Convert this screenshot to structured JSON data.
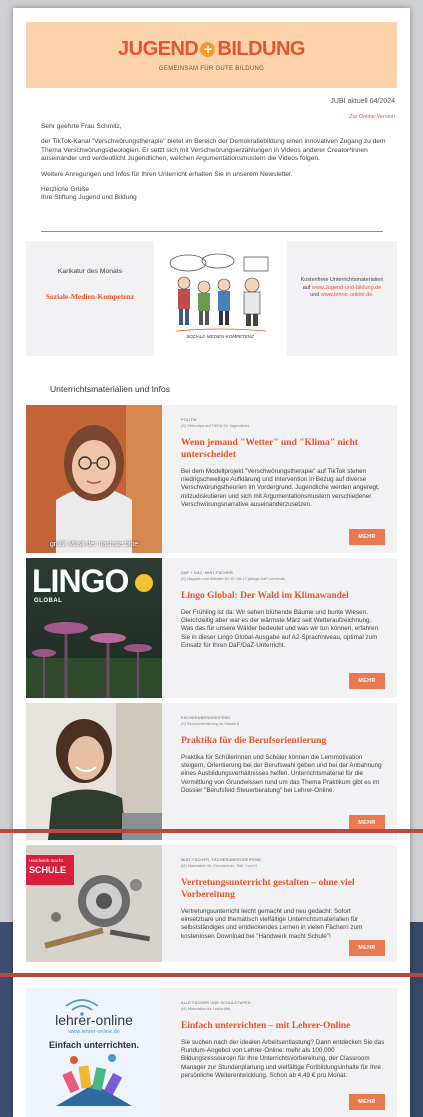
{
  "header": {
    "logo_left": "JUGEND",
    "logo_plus": "+",
    "logo_right": "BILDUNG",
    "tagline": "GEMEINSAM FÜR GUTE BILDUNG"
  },
  "issue": "JUBI aktuell 04/2024",
  "online_link": "Zur Online-Version",
  "letter": {
    "greeting": "Sehr geehrte Frau Schmitz,",
    "p1": "der TikTok-Kanal \"Verschwörungstherapie\" bietet im Bereich der Demokratiebildung einen innovativen Zugang zu dem Thema Verschwörungsideologien. Er setzt sich mit Verschwörungserzählungen in Videos anderer Creator*innen auseinander und verdeutlicht Jugendlichen, welchen Argumentationsmustern die Videos folgen.",
    "p2": "Weitere Anregungen und Infos für Ihren Unterricht erhalten Sie in unserem Newsletter.",
    "closing": "Herzliche Grüße",
    "signature": "Ihre Stiftung Jugend und Bildung"
  },
  "karikatur": {
    "title": "Karikatur des Monats",
    "subtitle": "Soziale-Medien-Kompetenz",
    "cartoon_caption": "SOZIALE-MEDIEN-KOMPETENZ",
    "right_text1": "Kostenfreie Unterrichtsmaterialien",
    "right_text2": "auf",
    "right_link1": "www.Jugend-und-bildung.de",
    "right_text3": "und",
    "right_link2": "www.lehrer-online.de."
  },
  "section_title": "Unterrichtsmaterialien und Infos",
  "cards": [
    {
      "category": "POLITIK",
      "sub": "(S) Videoclips auf TikTok für Jugendliche",
      "title": "Wenn jemand \"Wetter\" und \"Klima\" nicht unterscheidet",
      "text": "Bei dem Modellprojekt \"Verschwörungstherapie\" auf TikTok stehen niedrigschwellige Aufklärung und Intervention in Bezug auf diverse Verschwörungstheorien im Vordergrund. Jugendliche werden angeregt, mitzudiskutieren und sich mit Argumentationsmustern verschiedener Verschwörungsnarrative auseinanderzusetzen.",
      "button": "MEHR",
      "thumb_caption": "grüßt Müsli der nächste bitte"
    },
    {
      "category": "DAF + DAZ, MINT-FÄCHER",
      "sub": "(S) Magazin und Website für 15- bis 17-jährige DaF-Lernende",
      "title": "Lingo Global: Der Wald im Klimawandel",
      "text": "Der Frühling ist da: Wir sehen blühende Bäume und bunte Wiesen. Gleichzeitig aber war es der wärmste März seit Wetteraufzeichnung. Was das für unsere Wälder bedeutet und was wir tun können, erfahren Sie in dieser Lingo Global-Ausgabe auf A2-Sprachniveau, optimal zum Einsatz für Ihren DaF/DaZ-Unterricht.",
      "button": "MEHR",
      "thumb_logo": "LINGO",
      "thumb_sub": "GLOBAL"
    },
    {
      "category": "FÄCHERÜBERGREIFEND",
      "sub": "(S) Berufsorientierung ab Klasse 8",
      "title": "Praktika für die Berufsorientierung",
      "text": "Praktika für Schülerinnen und Schüler können die Lernmotivation steigern, Orientierung bei der Berufswahl geben und bei der Anbahnung eines Ausbildungsverhältnisses helfen. Unterrichtsmaterial für die Vermittlung von Grundwissen rund um das Thema Praktikum gibt es im Dossier \"Berufsfeld Steuerberatung\" bei Lehrer-Online.",
      "button": "MEHR"
    },
    {
      "category": "MINT-FÄCHER, FÄCHERÜBERGREIFEND",
      "sub": "(M) Materialien für Grundschule, Sek. I und II",
      "title": "Vertretungsunterricht gestalten – ohne viel Vorbereitung",
      "text": "Vertretungsunterricht leicht gemacht und neu gedacht: Sofort einsetzbare und thematisch vielfältige Unterrichtsmaterialien für selbstständiges und entdeckendes Lernen in vielen Fächern zum kostenlosen Download bei \"Handwerk macht Schule\"!",
      "button": "MEHR",
      "thumb_badge1": "Handwerk macht",
      "thumb_badge2": "SCHULE"
    },
    {
      "category": "ALLE FÄCHER UND SCHULSTUFEN",
      "sub": "(M) Materialien für Lehrkräfte",
      "title": "Einfach unterrichten – mit Lehrer-Online",
      "text": "Sie suchen nach der idealen Arbeitsentlastung? Dann entdecken Sie das Rundum-Angebot von Lehrer-Online: mehr als 100.000 Bildungsressourcen für Ihre Unterrichtsvorbereitung, der Classroom Manager zur Stundenplanung und vielfältige Fortbildungsinhalte für Ihre persönliche Weiterentwicklung. Schon ab 4,49 € pro Monat.",
      "button": "MEHR",
      "thumb_brand": "lehrer-online",
      "thumb_url": "www.lehrer-online.de",
      "thumb_slogan": "Einfach unterrichten."
    }
  ],
  "colors": {
    "accent": "#e8542c",
    "header_bg": "#fdd3ae",
    "card_bg": "#f2f2f4",
    "button_bg": "#e97a4f"
  }
}
